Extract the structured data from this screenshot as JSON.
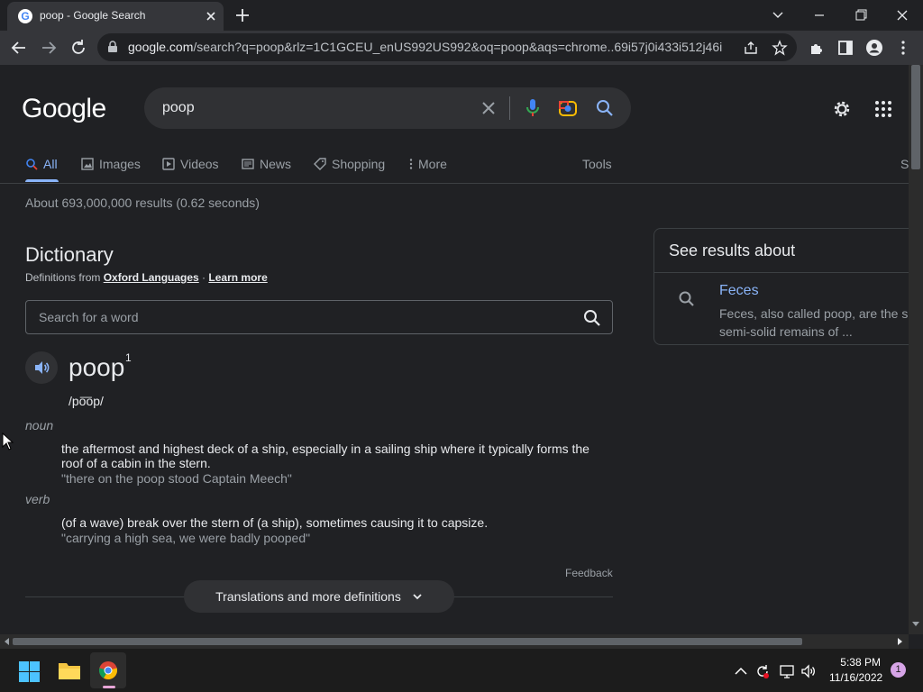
{
  "browser": {
    "tab_title": "poop - Google Search",
    "url_host": "google.com",
    "url_rest": "/search?q=poop&rlz=1C1GCEU_enUS992US992&oq=poop&aqs=chrome..69i57j0i433i512j46i1...",
    "favicon": "G"
  },
  "header": {
    "logo": "Google",
    "query": "poop"
  },
  "nav": {
    "all": "All",
    "images": "Images",
    "videos": "Videos",
    "news": "News",
    "shopping": "Shopping",
    "more": "More",
    "tools": "Tools",
    "cut": "S"
  },
  "results": {
    "stats": "About 693,000,000 results (0.62 seconds)"
  },
  "dictionary": {
    "title": "Dictionary",
    "source_prefix": "Definitions from ",
    "source_name": "Oxford Languages",
    "source_sep": " · ",
    "learn_more": "Learn more",
    "search_placeholder": "Search for a word",
    "headword": "poop",
    "superscript": "1",
    "pronunciation": "/po͞op/",
    "senses": [
      {
        "pos": "noun",
        "definition": "the aftermost and highest deck of a ship, especially in a sailing ship where it typically forms the roof of a cabin in the stern.",
        "example": "\"there on the poop stood Captain Meech\""
      },
      {
        "pos": "verb",
        "definition": "(of a wave) break over the stern of (a ship), sometimes causing it to capsize.",
        "example": "\"carrying a high sea, we were badly pooped\""
      }
    ],
    "feedback": "Feedback",
    "more_button": "Translations and more definitions"
  },
  "side_panel": {
    "heading": "See results about",
    "link": "Feces",
    "snippet": "Feces, also called poop, are the s or semi-solid remains of ..."
  },
  "taskbar": {
    "time": "5:38 PM",
    "date": "11/16/2022",
    "notifications": "1"
  },
  "icons": [
    "search-icon",
    "close-icon",
    "mic-icon",
    "camera-icon",
    "gear-icon",
    "apps-grid-icon",
    "speaker-icon",
    "chevron-down-icon"
  ],
  "colors": {
    "background": "#202124",
    "accent": "#8ab4f8",
    "text": "#e8eaed"
  }
}
